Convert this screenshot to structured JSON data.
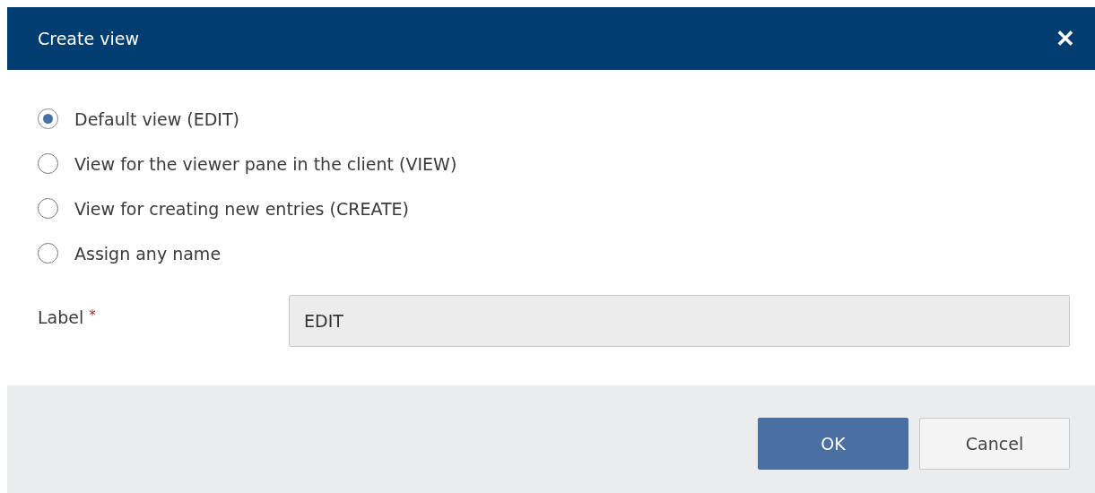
{
  "dialog": {
    "title": "Create view",
    "close": "✕"
  },
  "options": [
    {
      "label": "Default view (EDIT)",
      "selected": true
    },
    {
      "label": "View for the viewer pane in the client (VIEW)",
      "selected": false
    },
    {
      "label": "View for creating new entries (CREATE)",
      "selected": false
    },
    {
      "label": "Assign any name",
      "selected": false
    }
  ],
  "field": {
    "label": "Label",
    "required_mark": "*",
    "value": "EDIT"
  },
  "buttons": [
    {
      "label": "OK",
      "kind": "primary"
    },
    {
      "label": "Cancel",
      "kind": "secondary"
    }
  ]
}
